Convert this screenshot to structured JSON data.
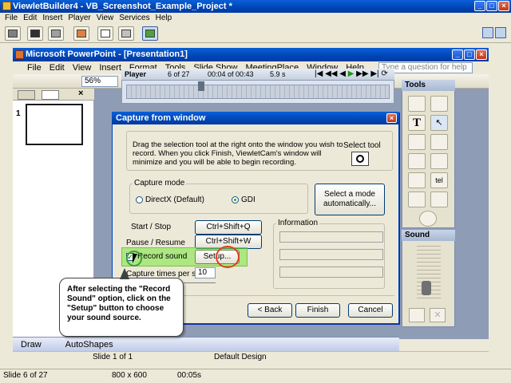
{
  "viewlet": {
    "title": "ViewletBuilder4 - VB_Screenshot_Example_Project *",
    "menu": [
      "File",
      "Edit",
      "Insert",
      "Player",
      "View",
      "Services",
      "Help"
    ]
  },
  "powerpoint": {
    "title": "Microsoft PowerPoint - [Presentation1]",
    "menu": [
      "File",
      "Edit",
      "View",
      "Insert",
      "Format",
      "Tools",
      "Slide Show",
      "MeetingPlace",
      "Window",
      "Help"
    ],
    "help_placeholder": "Type a question for help",
    "zoom": "56%",
    "slide_number": "1",
    "drawbar": {
      "draw_label": "Draw",
      "autoshapes_label": "AutoShapes"
    },
    "status": {
      "slide": "Slide 1 of 1",
      "design": "Default Design"
    }
  },
  "player": {
    "title": "Player",
    "slide_counter": "6 of 27",
    "time": "00:04 of 00:43",
    "duration": "5.9 s"
  },
  "tools_panel": {
    "title": "Tools"
  },
  "sound_panel": {
    "title": "Sound"
  },
  "dialog": {
    "title": "Capture from window",
    "instructions": "Drag the selection tool at the right onto the window you wish to record. When you click Finish, ViewletCam's window will minimize and you will be able to begin recording.",
    "select_tool_label": "Select tool",
    "capture_mode": {
      "legend": "Capture mode",
      "options": [
        "DirectX (Default)",
        "GDI"
      ],
      "selected": "GDI"
    },
    "select_mode_button": "Select a mode automatically...",
    "start_stop_label": "Start / Stop",
    "start_stop_hotkey": "Ctrl+Shift+Q",
    "pause_resume_label": "Pause / Resume",
    "pause_resume_hotkey": "Ctrl+Shift+W",
    "record_sound_label": "Record sound",
    "record_sound_checked": true,
    "setup_button": "Setup...",
    "information_legend": "Information",
    "capture_times_label": "Capture times per sec",
    "capture_times_value": "10",
    "back_button": "< Back",
    "finish_button": "Finish",
    "cancel_button": "Cancel"
  },
  "callout": {
    "text": "After selecting the \"Record Sound\" option, click on the \"Setup\" button to choose your sound source."
  },
  "statusbar": {
    "slide": "Slide 6 of 27",
    "size": "800 x 600",
    "time": "00:05s"
  }
}
